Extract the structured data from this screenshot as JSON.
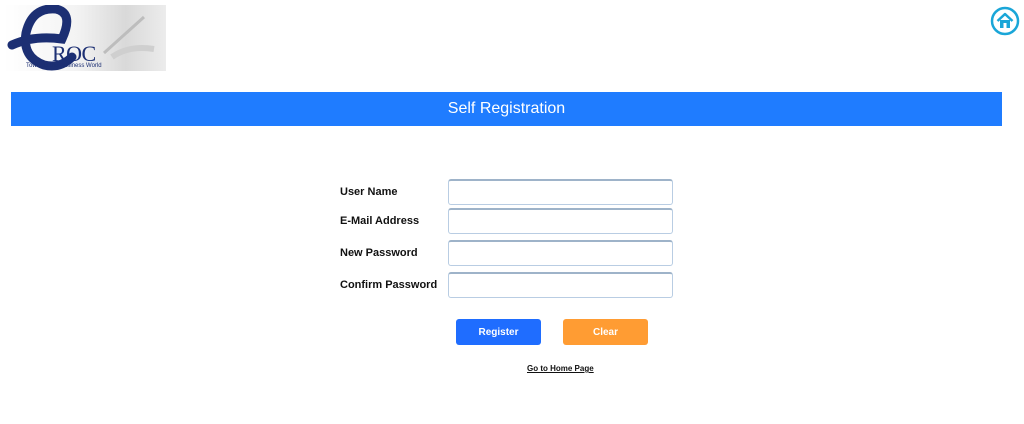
{
  "logo": {
    "text": "ROC",
    "tagline": "Towards the Business World"
  },
  "home_icon": "home-icon",
  "banner": {
    "title": "Self Registration"
  },
  "form": {
    "fields": [
      {
        "label": "User Name",
        "value": "",
        "placeholder": ""
      },
      {
        "label": "E-Mail Address",
        "value": "",
        "placeholder": ""
      },
      {
        "label": "New Password",
        "value": "",
        "placeholder": ""
      },
      {
        "label": "Confirm Password",
        "value": "",
        "placeholder": ""
      }
    ]
  },
  "buttons": {
    "register": "Register",
    "clear": "Clear"
  },
  "links": {
    "home_page": "Go to Home Page"
  },
  "colors": {
    "banner": "#1f7cff",
    "register_button": "#1f6dff",
    "clear_button": "#ff9c33",
    "home_icon": "#1aa6d8"
  }
}
